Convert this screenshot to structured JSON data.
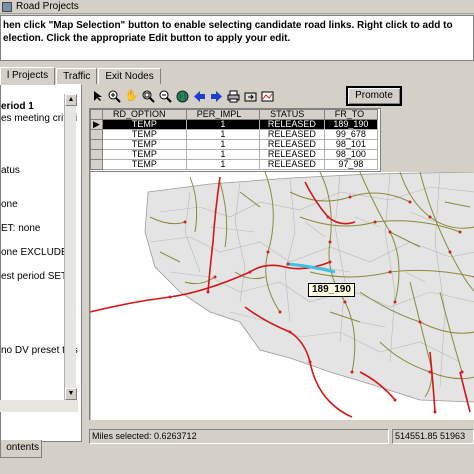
{
  "window": {
    "title": "Road Projects"
  },
  "instructions": {
    "line1": "hen click \"Map Selection\" button to enable selecting candidate road links. Right click to add to",
    "line2": "election. Click the appropriate Edit button to apply your edit."
  },
  "tabs": [
    {
      "label": "l Projects"
    },
    {
      "label": "Traffic"
    },
    {
      "label": "Exit Nodes"
    }
  ],
  "left_panel": {
    "lines": [
      "eriod 1",
      "es meeting criteri",
      "atus",
      "one",
      "ET: none",
      "one EXCLUDED",
      "est period SET",
      "no DV preset this"
    ],
    "bottom_tab": "ontents"
  },
  "toolbar": {
    "icons": [
      "pointer-icon",
      "zoom-in-icon",
      "pan-hand-icon",
      "zoom-extent-icon",
      "zoom-out-icon",
      "globe-icon",
      "back-arrow-icon",
      "forward-arrow-icon",
      "print-icon",
      "export-icon",
      "select-map-icon"
    ],
    "promote_label": "Promote"
  },
  "grid": {
    "columns": [
      "RD_OPTION",
      "PER_IMPL",
      "STATUS",
      "FR_TO"
    ],
    "rows": [
      [
        "TEMP",
        "1",
        "RELEASED",
        "189_190"
      ],
      [
        "TEMP",
        "1",
        "RELEASED",
        "99_678"
      ],
      [
        "TEMP",
        "1",
        "RELEASED",
        "98_101"
      ],
      [
        "TEMP",
        "1",
        "RELEASED",
        "98_100"
      ],
      [
        "TEMP",
        "1",
        "RELEASED",
        "97_98"
      ]
    ],
    "selected_row": 0
  },
  "map": {
    "selected_label": "189_190"
  },
  "status": {
    "miles_selected": "Miles selected: 0.6263712",
    "coordinates": "514551.85 51963"
  },
  "colors": {
    "road": "#8a8a3a",
    "highlight_road": "#d01818",
    "selected_link": "#40c0e0",
    "node": "#cc2222"
  }
}
